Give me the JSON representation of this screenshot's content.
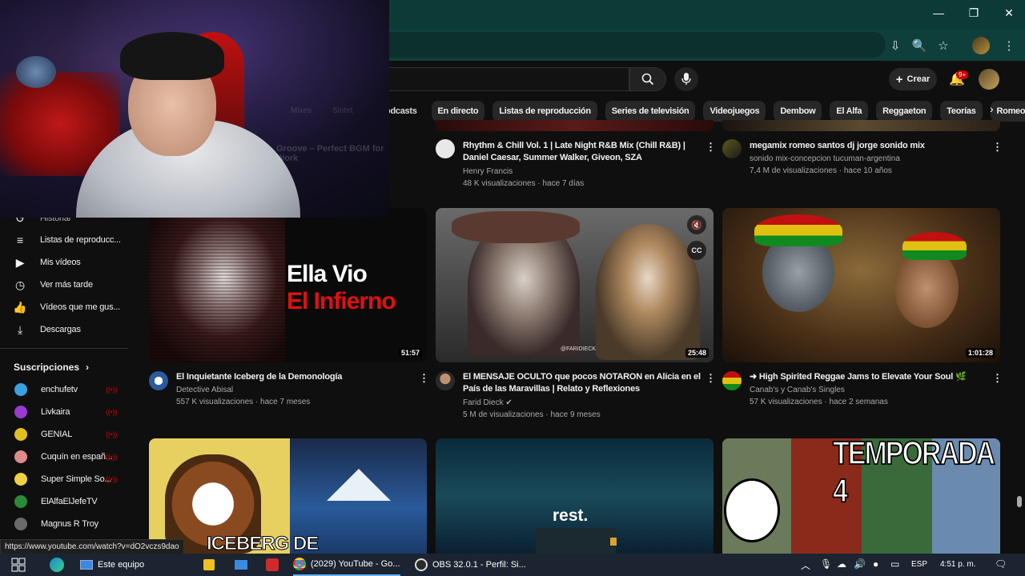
{
  "window_controls": {
    "minimize": "—",
    "maximize": "❐",
    "close": "✕"
  },
  "header": {
    "create_label": "Crear",
    "notif_count": "9+"
  },
  "chips": [
    "Podcasts",
    "En directo",
    "Listas de reproducción",
    "Series de televisión",
    "Videojuegos",
    "Dembow",
    "El Alfa",
    "Reggaeton",
    "Teorías",
    "Romeo Santos"
  ],
  "webcam_hidden_text": {
    "chips": [
      "Mixes",
      "Sintet"
    ],
    "video_title": "Groove – Perfect BGM for Work"
  },
  "sidebar": {
    "items": [
      {
        "icon": "history-icon",
        "glyph": "↺",
        "label": "Historial"
      },
      {
        "icon": "playlist-icon",
        "glyph": "≡",
        "label": "Listas de reproducc..."
      },
      {
        "icon": "my-videos-icon",
        "glyph": "▶",
        "label": "Mis vídeos"
      },
      {
        "icon": "clock-icon",
        "glyph": "◷",
        "label": "Ver más tarde"
      },
      {
        "icon": "thumbs-up-icon",
        "glyph": "👍",
        "label": "Vídeos que me gus..."
      },
      {
        "icon": "download-icon",
        "glyph": "⤓",
        "label": "Descargas"
      }
    ],
    "subs_title": "Suscripciones",
    "subs": [
      {
        "name": "enchufetv",
        "color": "#3aa0e0",
        "live": "((•))"
      },
      {
        "name": "Livkaira",
        "color": "#9a3ad0",
        "live": "((•))"
      },
      {
        "name": "GENIAL",
        "color": "#e0c020",
        "live": "((•))"
      },
      {
        "name": "Cuquín en españ...",
        "color": "#e08a8a",
        "live": "((•))"
      },
      {
        "name": "Super Simple So...",
        "color": "#f0d040",
        "live": "((•))"
      },
      {
        "name": "ElAlfaElJefeTV",
        "color": "#2a8a3a",
        "live": ""
      },
      {
        "name": "Magnus R Troy",
        "color": "#6a6a6a",
        "live": ""
      }
    ]
  },
  "row1": [
    {
      "title1": "Rhythm & Chill Vol. 1 | Late Night R&B Mix (Chill R&B) |",
      "title2": "Daniel Caesar, Summer Walker, Giveon, SZA",
      "channel": "Henry Francis",
      "meta": "48 K visualizaciones · hace 7 días"
    },
    {
      "title1": "megamix romeo santos dj jorge sonido mix",
      "title2": "",
      "channel": "sonido mix-concepcion tucuman-argentina",
      "meta": "7,4 M de visualizaciones · hace 10 años"
    }
  ],
  "row2": [
    {
      "thumb_line1": "Ella Vio",
      "thumb_line2": "El Infierno",
      "duration": "51:57",
      "title1": "El Inquietante Iceberg de la Demonología",
      "title2": "",
      "channel": "Detective Abisal",
      "meta": "557 K visualizaciones · hace 7 meses"
    },
    {
      "thumb_watermark": "@FARIDIECK",
      "duration": "25:48",
      "title1": "El MENSAJE OCULTO que pocos NOTARON en Alicia en el",
      "title2": "País de las Maravillas | Relato y Reflexiones",
      "channel": "Farid Dieck ✔",
      "meta": "5 M de visualizaciones · hace 9 meses"
    },
    {
      "duration": "1:01:28",
      "title1": "➜ High Spirited Reggae Jams to Elevate Your Soul 🌿",
      "title2": "",
      "channel": "Canab's y Canab's Singles",
      "meta": "57 K visualizaciones · hace 2 semanas"
    }
  ],
  "row3": [
    {
      "thumb_text": "ICEBERG DE"
    },
    {
      "thumb_text": "rest."
    },
    {
      "thumb_text": "TEMPORADA 4"
    }
  ],
  "status_url": "https://www.youtube.com/watch?v=dO2vczs9dao",
  "taskbar": {
    "explorer": "Este equipo",
    "chrome": "(2029) YouTube - Go...",
    "obs": "OBS 32.0.1 - Perfil: Si...",
    "lang": "ESP",
    "time": "4:51 p. m."
  }
}
